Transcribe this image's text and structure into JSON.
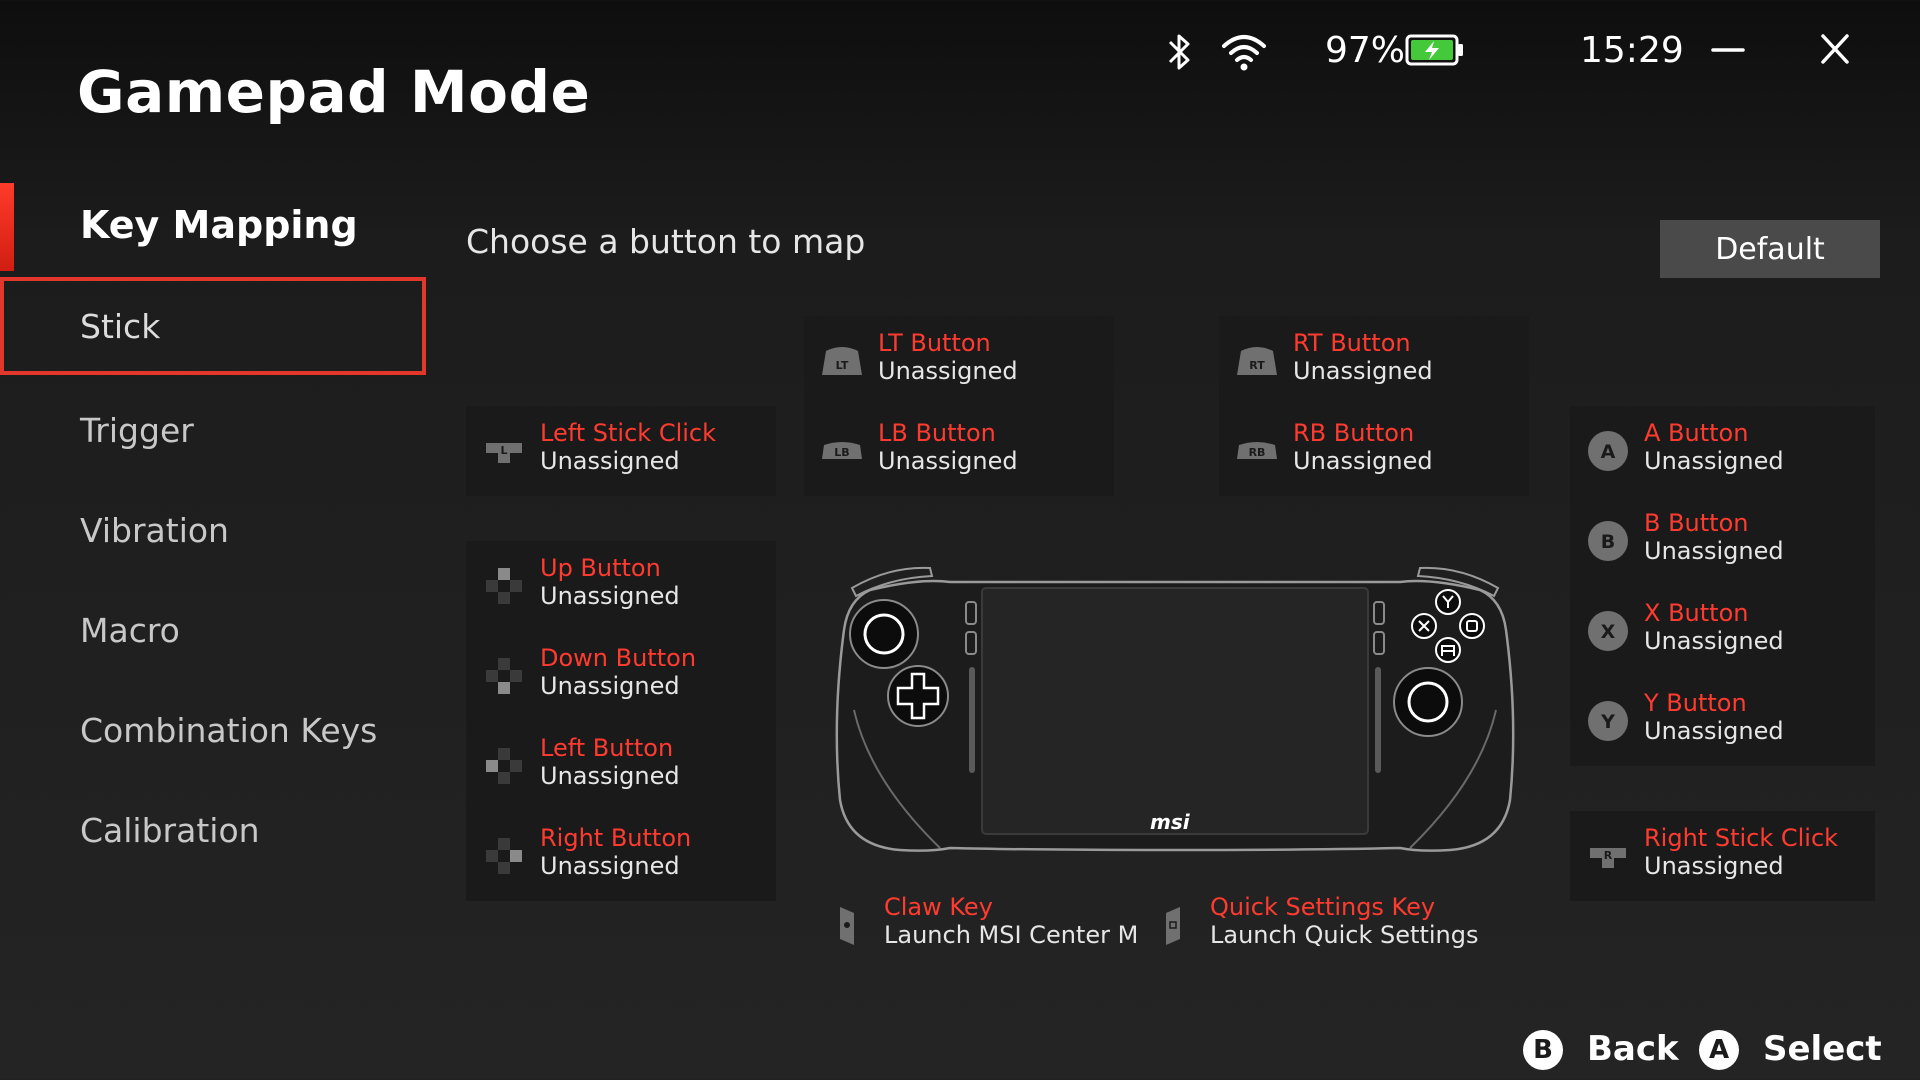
{
  "app": {
    "title": "Gamepad Mode"
  },
  "status": {
    "battery": "97%",
    "time": "15:29"
  },
  "sidebar": {
    "section": "Key Mapping",
    "items": [
      {
        "label": "Stick"
      },
      {
        "label": "Trigger"
      },
      {
        "label": "Vibration"
      },
      {
        "label": "Macro"
      },
      {
        "label": "Combination Keys"
      },
      {
        "label": "Calibration"
      }
    ]
  },
  "main": {
    "subtitle": "Choose a button to map",
    "default_label": "Default",
    "shoulders_left": [
      {
        "name": "LT Button",
        "value": "Unassigned",
        "icon_text": "LT"
      },
      {
        "name": "LB Button",
        "value": "Unassigned",
        "icon_text": "LB"
      }
    ],
    "shoulders_right": [
      {
        "name": "RT Button",
        "value": "Unassigned",
        "icon_text": "RT"
      },
      {
        "name": "RB Button",
        "value": "Unassigned",
        "icon_text": "RB"
      }
    ],
    "left_stick": {
      "name": "Left Stick Click",
      "value": "Unassigned",
      "icon_text": "L"
    },
    "right_stick": {
      "name": "Right Stick Click",
      "value": "Unassigned",
      "icon_text": "R"
    },
    "dpad": [
      {
        "name": "Up Button",
        "value": "Unassigned"
      },
      {
        "name": "Down Button",
        "value": "Unassigned"
      },
      {
        "name": "Left Button",
        "value": "Unassigned"
      },
      {
        "name": "Right Button",
        "value": "Unassigned"
      }
    ],
    "face": [
      {
        "name": "A Button",
        "value": "Unassigned",
        "icon_text": "A"
      },
      {
        "name": "B Button",
        "value": "Unassigned",
        "icon_text": "B"
      },
      {
        "name": "X Button",
        "value": "Unassigned",
        "icon_text": "X"
      },
      {
        "name": "Y Button",
        "value": "Unassigned",
        "icon_text": "Y"
      }
    ],
    "claw": {
      "name": "Claw Key",
      "value": "Launch MSI Center M"
    },
    "quick": {
      "name": "Quick Settings Key",
      "value": "Launch Quick Settings"
    },
    "device_logo": "msi"
  },
  "footer": {
    "back": {
      "glyph": "B",
      "label": "Back"
    },
    "select": {
      "glyph": "A",
      "label": "Select"
    }
  },
  "colors": {
    "accent": "#ff3b30",
    "panel": "#1a1a1a",
    "default_btn": "#4a4a4a"
  }
}
